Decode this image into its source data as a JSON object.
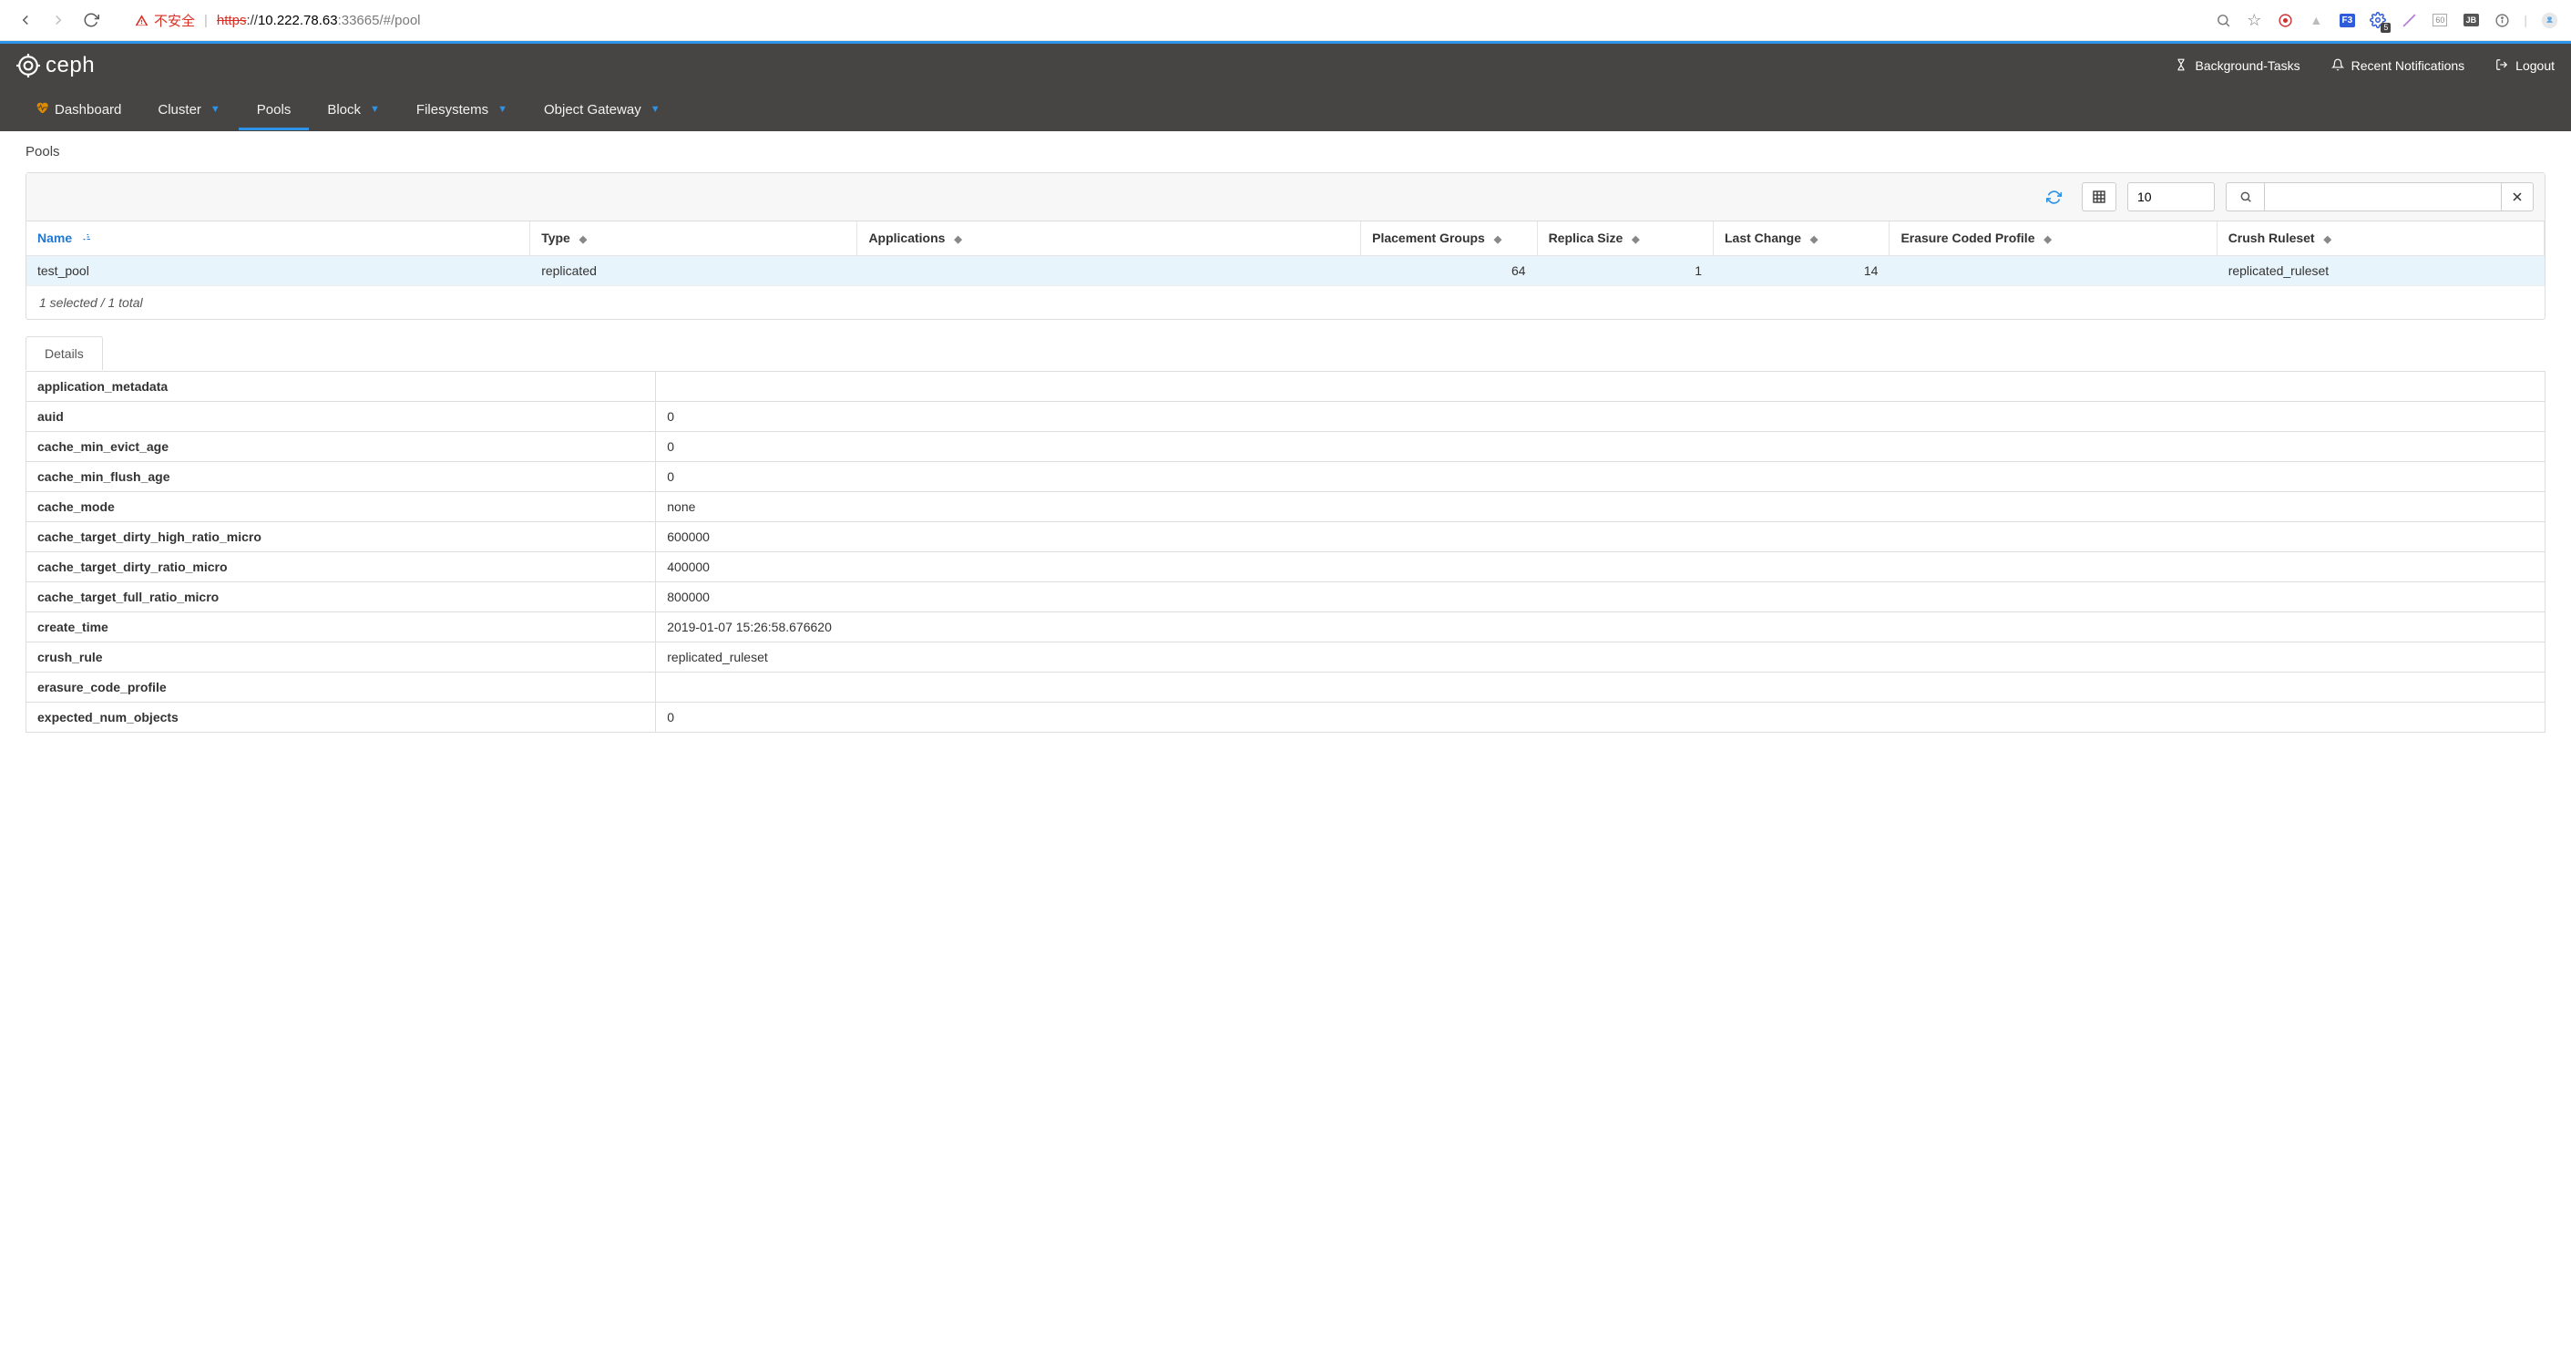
{
  "browser": {
    "insecure_label": "不安全",
    "url_scheme": "https",
    "url_host": "10.222.78.63",
    "url_port": ":33665",
    "url_path": "/#/pool",
    "gear_badge": "5"
  },
  "header": {
    "brand": "ceph",
    "background_tasks": "Background-Tasks",
    "recent_notifications": "Recent Notifications",
    "logout": "Logout"
  },
  "nav": {
    "dashboard": "Dashboard",
    "cluster": "Cluster",
    "pools": "Pools",
    "block": "Block",
    "filesystems": "Filesystems",
    "object_gateway": "Object Gateway"
  },
  "breadcrumb": "Pools",
  "toolbar": {
    "page_size": "10"
  },
  "columns": {
    "name": "Name",
    "type": "Type",
    "applications": "Applications",
    "pg": "Placement Groups",
    "replica": "Replica Size",
    "last_change": "Last Change",
    "ec_profile": "Erasure Coded Profile",
    "crush_ruleset": "Crush Ruleset"
  },
  "rows": [
    {
      "name": "test_pool",
      "type": "replicated",
      "applications": "",
      "pg": "64",
      "replica": "1",
      "last_change": "14",
      "ec_profile": "",
      "crush_ruleset": "replicated_ruleset"
    }
  ],
  "footer": "1 selected / 1 total",
  "tabs": {
    "details": "Details"
  },
  "details": [
    {
      "k": "application_metadata",
      "v": ""
    },
    {
      "k": "auid",
      "v": "0"
    },
    {
      "k": "cache_min_evict_age",
      "v": "0"
    },
    {
      "k": "cache_min_flush_age",
      "v": "0"
    },
    {
      "k": "cache_mode",
      "v": "none"
    },
    {
      "k": "cache_target_dirty_high_ratio_micro",
      "v": "600000"
    },
    {
      "k": "cache_target_dirty_ratio_micro",
      "v": "400000"
    },
    {
      "k": "cache_target_full_ratio_micro",
      "v": "800000"
    },
    {
      "k": "create_time",
      "v": "2019-01-07 15:26:58.676620"
    },
    {
      "k": "crush_rule",
      "v": "replicated_ruleset"
    },
    {
      "k": "erasure_code_profile",
      "v": ""
    },
    {
      "k": "expected_num_objects",
      "v": "0"
    }
  ]
}
